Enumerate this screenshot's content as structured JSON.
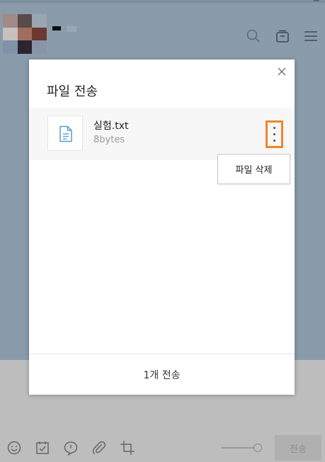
{
  "colors": {
    "chat_bg": "#8a9bab",
    "input_bg": "#bdbdbd",
    "highlight": "#f0862b",
    "file_icon": "#5b9bd5"
  },
  "chat_header": {
    "icons": [
      "search-icon",
      "drawer-icon",
      "menu-icon"
    ]
  },
  "dialog": {
    "title": "파일 전송",
    "file": {
      "name": "실험.txt",
      "size": "8bytes",
      "icon": "document-icon"
    },
    "context_menu": {
      "delete_label": "파일 삭제"
    },
    "send_button_label": "1개 전송"
  },
  "toolbar": {
    "icons": [
      "emoticon-icon",
      "calendar-check-icon",
      "chat-bubble-icon",
      "paperclip-icon",
      "crop-icon"
    ],
    "send_label": "전송"
  }
}
